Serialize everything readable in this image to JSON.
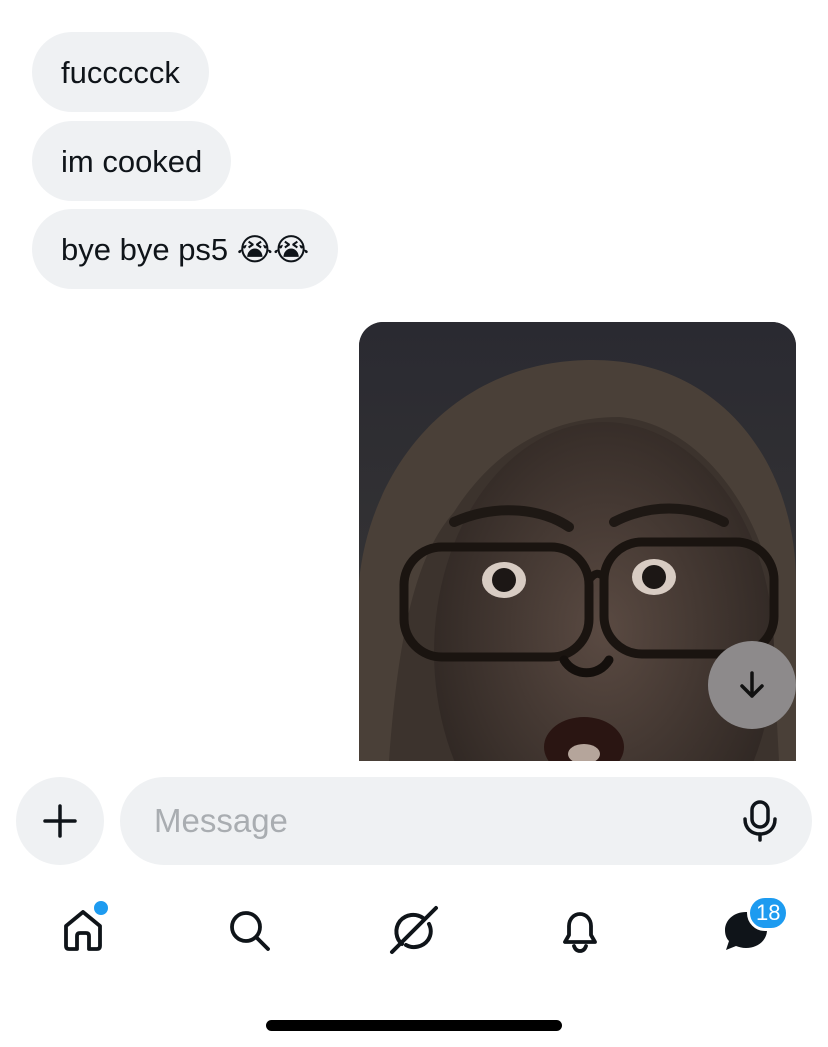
{
  "conversation": {
    "messages": [
      {
        "text": "fuccccck",
        "direction": "received"
      },
      {
        "text": "im cooked",
        "direction": "received"
      },
      {
        "text": "bye bye ps5 😭😭",
        "direction": "received"
      }
    ],
    "sent_media": {
      "type": "photo",
      "description_icon": "photo-thumbnail"
    }
  },
  "scroll_to_bottom": {
    "icon": "arrow-down-icon"
  },
  "composer": {
    "add_icon": "plus-icon",
    "placeholder": "Message",
    "value": "",
    "mic_icon": "microphone-icon"
  },
  "tab_bar": {
    "items": [
      {
        "name": "home",
        "icon": "home-icon",
        "has_dot": true
      },
      {
        "name": "search",
        "icon": "search-icon"
      },
      {
        "name": "grok",
        "icon": "grok-icon"
      },
      {
        "name": "notifications",
        "icon": "bell-icon"
      },
      {
        "name": "messages",
        "icon": "message-bubble-icon",
        "badge": "18"
      }
    ]
  },
  "colors": {
    "accent": "#1d9bf0",
    "bubble": "#eff1f3",
    "text": "#0f1419",
    "placeholder": "#a9adb1"
  }
}
